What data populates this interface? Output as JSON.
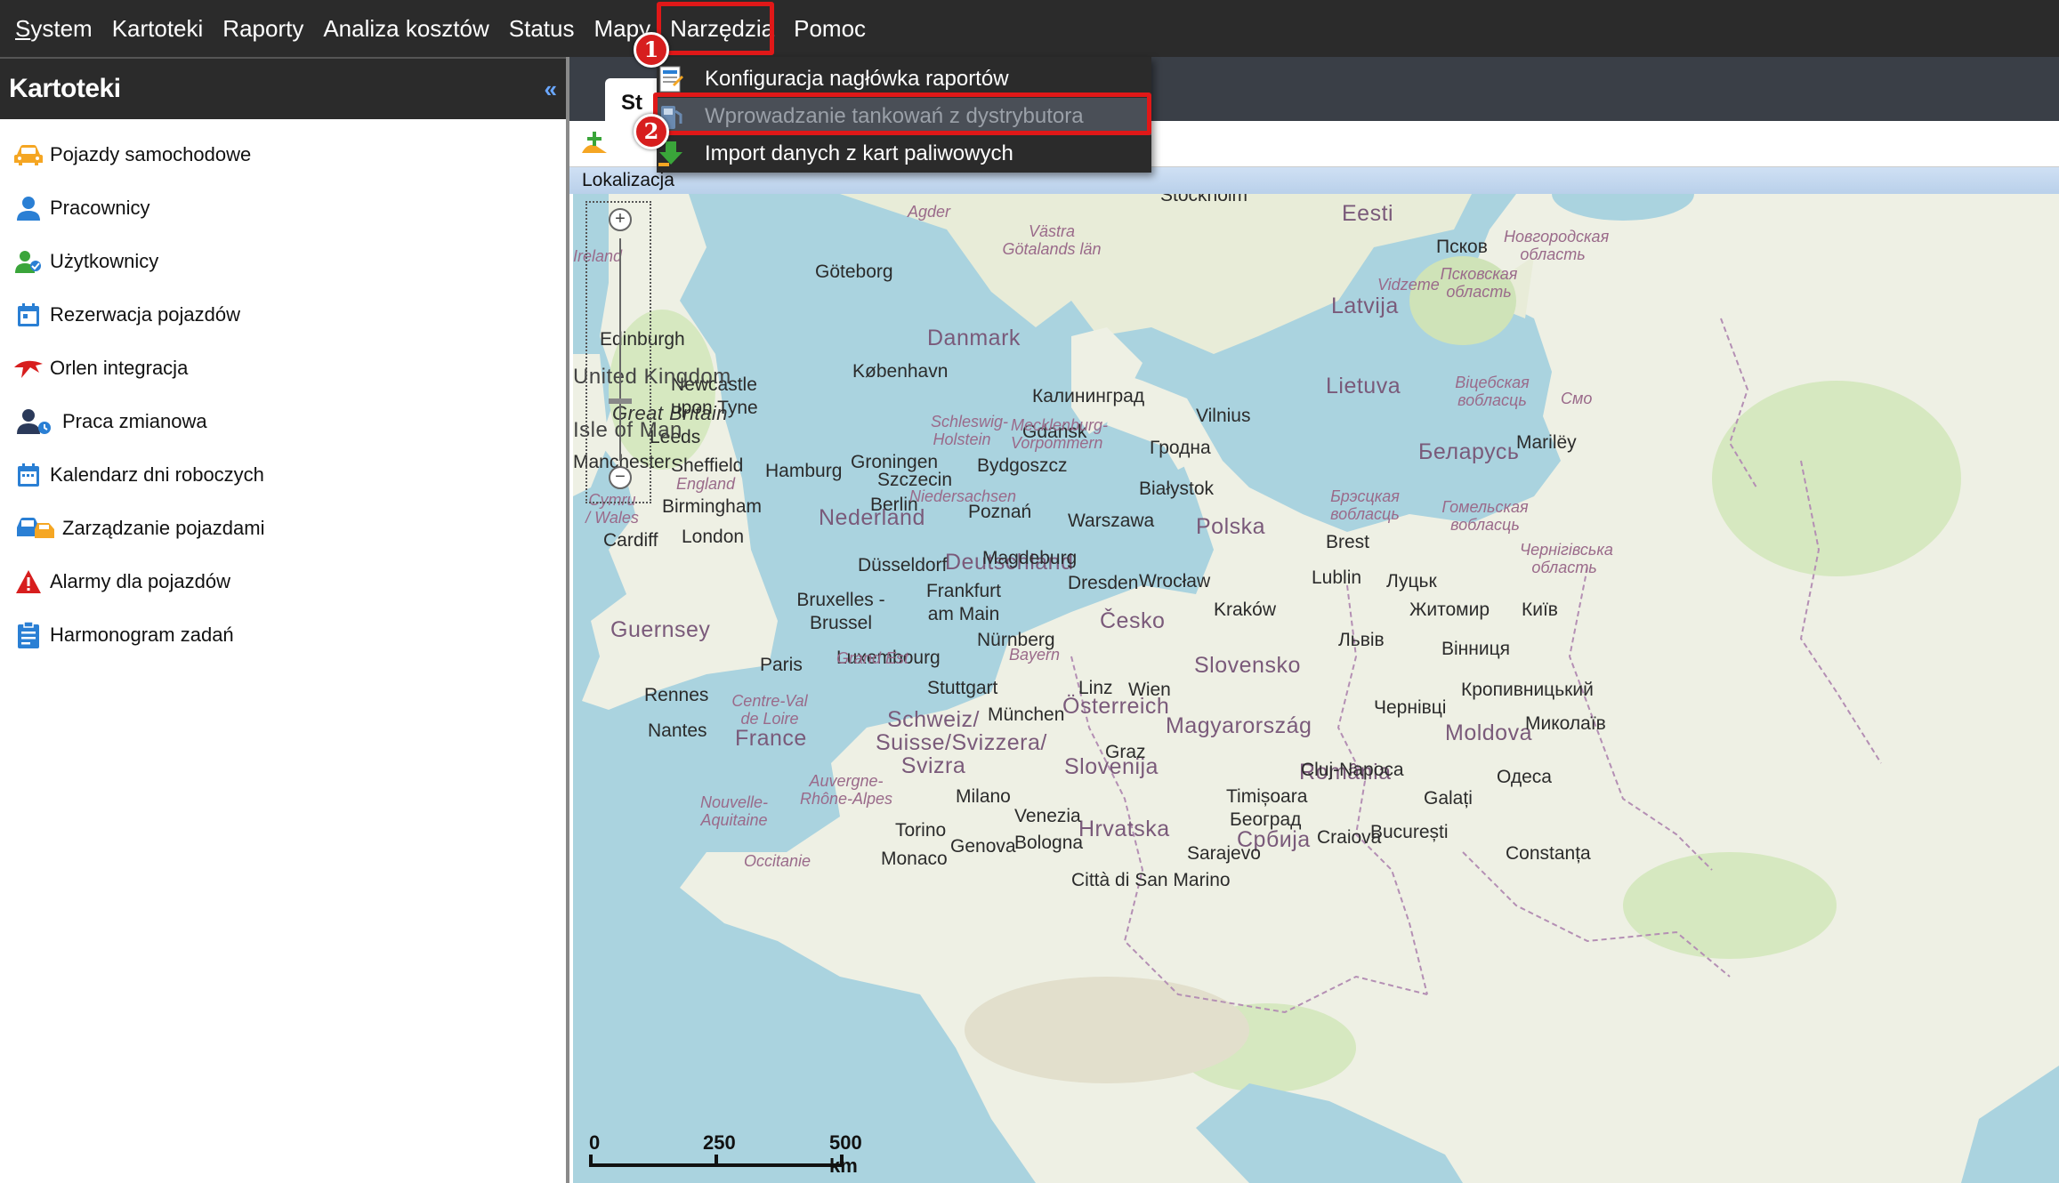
{
  "menubar": {
    "items": [
      "System",
      "Kartoteki",
      "Raporty",
      "Analiza kosztów",
      "Status",
      "Mapy",
      "Narzędzia",
      "Pomoc"
    ]
  },
  "dropdown": {
    "items": [
      {
        "label": "Konfiguracja nagłówka raportów",
        "icon": "report-header-icon",
        "enabled": true
      },
      {
        "label": "Wprowadzanie tankowań z dystrybutora",
        "icon": "fuel-dispenser-icon",
        "enabled": false
      },
      {
        "label": "Import danych z kart paliwowych",
        "icon": "import-arrow-icon",
        "enabled": true
      }
    ]
  },
  "annotations": {
    "step1": "1",
    "step2": "2"
  },
  "left_panel": {
    "title": "Kartoteki",
    "collapse_symbol": "«",
    "items": [
      {
        "label": "Pojazdy samochodowe",
        "icon": "car-icon",
        "color": "#f5a623"
      },
      {
        "label": "Pracownicy",
        "icon": "person-icon",
        "color": "#2a7fd4"
      },
      {
        "label": "Użytkownicy",
        "icon": "users-icon",
        "color": "#3aa53a"
      },
      {
        "label": "Rezerwacja pojazdów",
        "icon": "calendar-check-icon",
        "color": "#2a7fd4"
      },
      {
        "label": "Orlen integracja",
        "icon": "orlen-eagle-icon",
        "color": "#d71e1e"
      },
      {
        "label": "Praca zmianowa",
        "icon": "shift-person-icon",
        "color": "#2b3a5a"
      },
      {
        "label": "Kalendarz dni roboczych",
        "icon": "calendar-icon",
        "color": "#2a7fd4"
      },
      {
        "label": "Zarządzanie pojazdami",
        "icon": "fleet-icon",
        "color": "#2a7fd4"
      },
      {
        "label": "Alarmy dla pojazdów",
        "icon": "alarm-triangle-icon",
        "color": "#d71e1e"
      },
      {
        "label": "Harmonogram zadań",
        "icon": "clipboard-icon",
        "color": "#2a7fd4"
      }
    ]
  },
  "main": {
    "tab_label": "St",
    "location_label": "Lokalizacja"
  },
  "map": {
    "countries": [
      "Danmark",
      "Eesti",
      "Latvija",
      "Lietuva",
      "Беларусь",
      "Polska",
      "Nederland",
      "Deutschland",
      "Česko",
      "Slovensko",
      "Österreich",
      "Magyarország",
      "France",
      "Schweiz/ Suisse/Svizzera/ Svizra",
      "Slovenija",
      "Hrvatska",
      "România",
      "Moldova",
      "Србија",
      "Great Britain",
      "Guernsey"
    ],
    "cities": [
      "Göteborg",
      "København",
      "Калининград",
      "Gdańsk",
      "Vilnius",
      "Гродна",
      "Hamburg",
      "Szczecin",
      "Bydgoszcz",
      "Białystok",
      "Berlin",
      "Poznań",
      "Warszawa",
      "Groningen",
      "Magdeburg",
      "Dresden",
      "Wrocław",
      "Lublin",
      "Луцьк",
      "Brest",
      "Düsseldorf",
      "Frankfurt am Main",
      "Kraków",
      "Житомир",
      "Київ",
      "Bruxelles - Brussel",
      "Nürnberg",
      "Львів",
      "Вінниця",
      "Luxembourg",
      "Paris",
      "Stuttgart",
      "Linz",
      "Wien",
      "Кропивницький",
      "Rennes",
      "München",
      "Чернівці",
      "Nantes",
      "Graz",
      "Cluj-Napoca",
      "Одеса",
      "Milano",
      "Timișoara",
      "Galați",
      "Venezia",
      "Београд",
      "Torino",
      "Genova",
      "Bologna",
      "Craiova",
      "București",
      "Monaco",
      "Sarajevo",
      "Constanța",
      "Edinburgh",
      "Newcastle upon Tyne",
      "Leeds",
      "Manchester",
      "Sheffield",
      "Birmingham",
      "Cardiff",
      "London",
      "Псков",
      "Marilëy",
      "Mиколаїв"
    ],
    "regions": [
      "Agder",
      "Västra Götalands län",
      "Schleswig-Holstein",
      "Mecklenburg-Vorpommern",
      "Niedersachsen",
      "England",
      "Cymru / Wales",
      "Bayern",
      "Grand Est",
      "Centre-Val de Loire",
      "Auvergne-Rhône-Alpes",
      "Nouvelle-Aquitaine",
      "Vidzeme",
      "Псковская область",
      "Новгородская область",
      "Віцебская вобласць",
      "Брэсцкая вобласць",
      "Гомельская вобласць",
      "Чернігівська область",
      "Occitanie"
    ],
    "partial": [
      "Stockholm",
      "United Kingdom",
      "Isle of Man",
      "Ireland",
      "Città di San Marino",
      "Смо"
    ],
    "scale": {
      "labels": [
        "0",
        "250",
        "500 km"
      ]
    },
    "zoom": {
      "plus": "+",
      "minus": "−"
    }
  }
}
